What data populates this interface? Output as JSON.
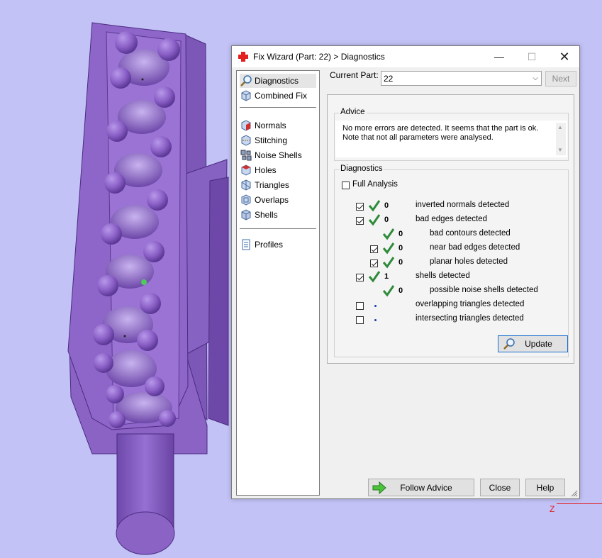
{
  "dialog": {
    "title": "Fix Wizard (Part: 22) > Diagnostics",
    "window_controls": {
      "minimize": "—",
      "maximize": "☐",
      "close": "✕"
    }
  },
  "nav": {
    "items": [
      {
        "label": "Diagnostics",
        "icon": "magnifier-icon",
        "selected": true
      },
      {
        "label": "Combined Fix",
        "icon": "cube-icon"
      },
      {
        "label": "Normals",
        "icon": "normals-cube-icon"
      },
      {
        "label": "Stitching",
        "icon": "stitching-cube-icon"
      },
      {
        "label": "Noise Shells",
        "icon": "noise-shells-icon"
      },
      {
        "label": "Holes",
        "icon": "holes-cube-icon"
      },
      {
        "label": "Triangles",
        "icon": "triangles-cube-icon"
      },
      {
        "label": "Overlaps",
        "icon": "overlaps-cube-icon"
      },
      {
        "label": "Shells",
        "icon": "shells-cube-icon"
      },
      {
        "label": "Profiles",
        "icon": "document-icon"
      }
    ]
  },
  "current_part": {
    "label": "Current Part:",
    "value": "22",
    "next_label": "Next"
  },
  "advice": {
    "title": "Advice",
    "lines": [
      "No more errors are detected. It seems that the part is ok.",
      "Note that not all parameters were analysed."
    ]
  },
  "diagnostics": {
    "title": "Diagnostics",
    "full_analysis_label": "Full Analysis",
    "full_analysis_checked": false,
    "rows": [
      {
        "count": "0",
        "label": "inverted normals detected",
        "checked": true,
        "has_checkbox": true,
        "status": "ok"
      },
      {
        "count": "0",
        "label": "bad edges detected",
        "checked": true,
        "has_checkbox": true,
        "status": "ok"
      },
      {
        "count": "0",
        "label": "bad contours detected",
        "checked": false,
        "has_checkbox": false,
        "status": "ok"
      },
      {
        "count": "0",
        "label": "near bad edges detected",
        "checked": true,
        "has_checkbox": true,
        "status": "ok"
      },
      {
        "count": "0",
        "label": "planar holes detected",
        "checked": true,
        "has_checkbox": true,
        "status": "ok"
      },
      {
        "count": "1",
        "label": "shells detected",
        "checked": true,
        "has_checkbox": true,
        "status": "ok"
      },
      {
        "count": "0",
        "label": "possible noise shells detected",
        "checked": false,
        "has_checkbox": false,
        "status": "ok"
      },
      {
        "count": "",
        "label": "overlapping triangles detected",
        "checked": false,
        "has_checkbox": true,
        "status": "pending"
      },
      {
        "count": "",
        "label": "intersecting triangles detected",
        "checked": false,
        "has_checkbox": true,
        "status": "pending"
      }
    ],
    "update_label": "Update"
  },
  "buttons": {
    "follow_advice": "Follow Advice",
    "close": "Close",
    "help": "Help"
  },
  "viewport": {
    "axis_label": "Z"
  },
  "colors": {
    "background": "#c2c2f6",
    "model": "#8e63c8",
    "check": "#2e8b3a",
    "accent": "#1a6fd0"
  }
}
